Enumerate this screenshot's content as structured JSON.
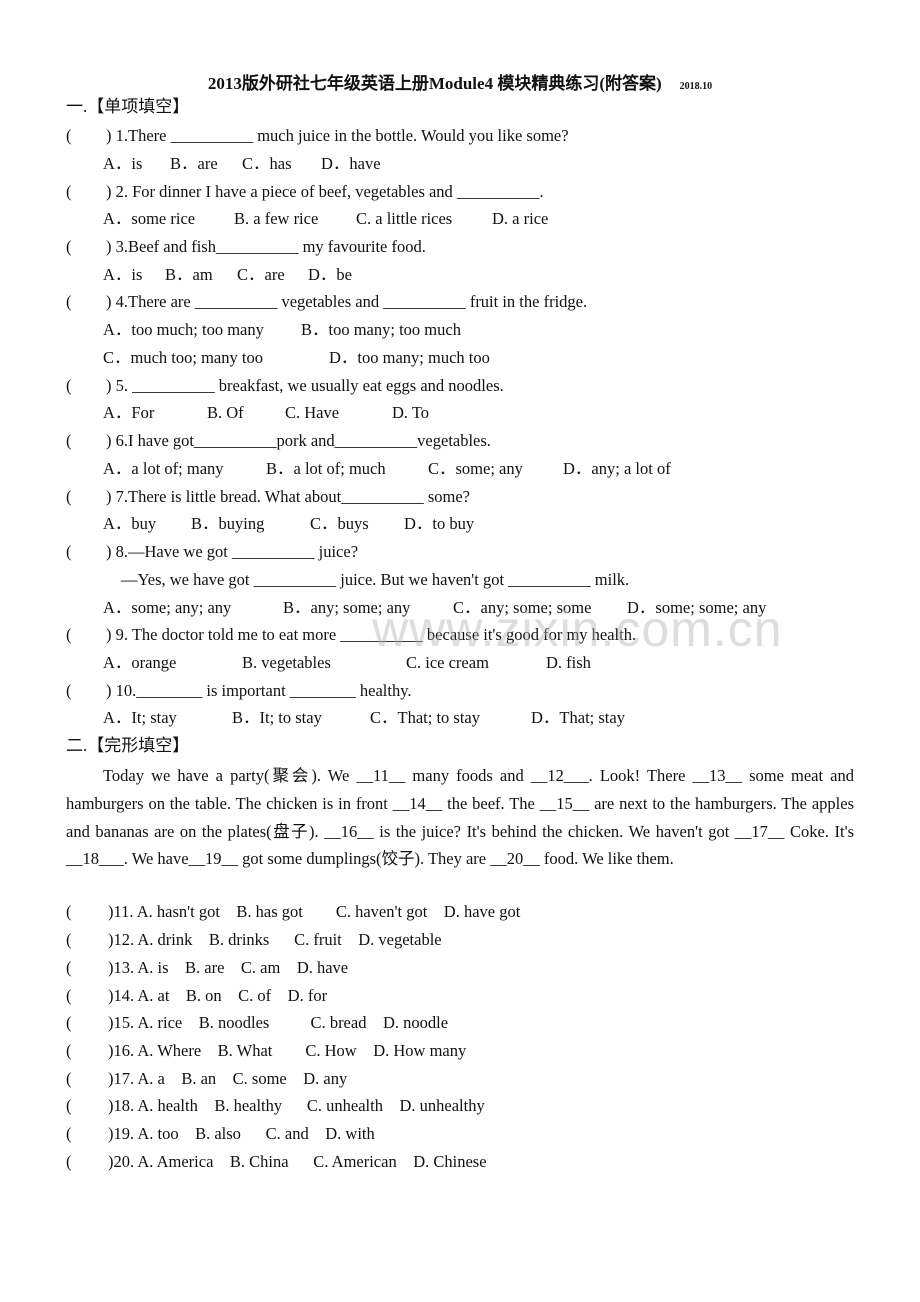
{
  "header": {
    "title": "2013版外研社七年级英语上册Module4  模块精典练习(附答案)",
    "date": "2018.10"
  },
  "section1": {
    "heading": "一.【单项填空】",
    "questions": [
      {
        "paren": "(",
        "close": ")",
        "number": "1.",
        "stem": "There __________ much juice in the bottle. Would you like some?",
        "options": [
          "A．is",
          "B．are",
          "C．has",
          "D．have"
        ]
      },
      {
        "paren": "(",
        "close": ")",
        "number": "2.",
        "stem": " For dinner I have a piece of beef, vegetables and __________.",
        "options": [
          "A．some rice",
          "B. a few rice",
          "C. a little rices",
          "D. a rice"
        ]
      },
      {
        "paren": "(",
        "close": ")",
        "number": "3.",
        "stem": "Beef and fish__________ my favourite food.",
        "options": [
          "A．is",
          "B．am",
          "C．are",
          "D．be"
        ]
      },
      {
        "paren": "(",
        "close": ")",
        "number": "4.",
        "stem": "There are __________ vegetables and __________ fruit in the fridge.",
        "options": [
          "A．too much; too many",
          "B．too many; too much",
          "C．much too; many too",
          "D．too many; much too"
        ]
      },
      {
        "paren": "(",
        "close": ")",
        "number": "5.",
        "stem": " __________ breakfast, we usually eat eggs and noodles.",
        "options": [
          "A．For",
          "B. Of",
          "C. Have",
          "D. To"
        ]
      },
      {
        "paren": "(",
        "close": ")",
        "number": "6.",
        "stem": "I have got__________pork and__________vegetables.",
        "options": [
          "A．a lot of; many",
          "B．a lot of; much",
          "C．some; any",
          "D．any; a lot of"
        ]
      },
      {
        "paren": "(",
        "close": ")",
        "number": "7.",
        "stem": "There is little bread. What about__________ some?",
        "options": [
          "A．buy",
          "B．buying",
          "C．buys",
          "D．to buy"
        ]
      },
      {
        "paren": "(",
        "close": ")",
        "number": "8.",
        "stem": "—Have we got __________ juice?",
        "stem2": "—Yes, we have got __________ juice. But we haven't got __________ milk.",
        "options": [
          "A．some; any; any",
          "B．any; some; any",
          "C．any; some; some",
          "D．some; some; any"
        ]
      },
      {
        "paren": "(",
        "close": ")",
        "number": "9.",
        "stem": " The doctor told me to eat more __________ because it's good for my health.",
        "options": [
          "A．orange",
          "B. vegetables",
          "C. ice cream",
          "D. fish"
        ]
      },
      {
        "paren": "(",
        "close": ")",
        "number": "10.",
        "stem": "________ is important ________ healthy.",
        "options": [
          "A．It; stay",
          "B．It; to stay",
          "C．That; to stay",
          "D．That; stay"
        ]
      }
    ]
  },
  "section2": {
    "heading": "二.【完形填空】",
    "passage": "Today we have a party(聚会). We __11__ many foods and __12___. Look! There __13__ some meat and hamburgers on the table. The chicken is in front __14__ the beef. The __15__ are next to the hamburgers. The apples and bananas are on the plates(盘子). __16__ is the juice? It's behind the chicken. We haven't got __17__ Coke. It's __18___. We have__19__ got some dumplings(饺子). They are __20__ food. We like them.",
    "questions": [
      {
        "paren": "(",
        "text": ")11. A. hasn't got    B. has got        C. haven't got    D. have got"
      },
      {
        "paren": "(",
        "text": ")12. A. drink    B. drinks      C. fruit    D. vegetable"
      },
      {
        "paren": "(",
        "text": ")13. A. is    B. are    C. am    D. have"
      },
      {
        "paren": "(",
        "text": ")14. A. at    B. on    C. of    D. for"
      },
      {
        "paren": "(",
        "text": ")15. A. rice    B. noodles          C. bread    D. noodle"
      },
      {
        "paren": "(",
        "text": ")16. A. Where    B. What        C. How    D. How many"
      },
      {
        "paren": "(",
        "text": ")17. A. a    B. an    C. some    D. any"
      },
      {
        "paren": "(",
        "text": ")18. A. health    B. healthy      C. unhealth    D. unhealthy"
      },
      {
        "paren": "(",
        "text": ")19. A. too    B. also      C. and    D. with"
      },
      {
        "paren": "(",
        "text": ")20. A. America    B. China      C. American    D. Chinese"
      }
    ]
  },
  "watermark": "www.zixin.com.cn"
}
